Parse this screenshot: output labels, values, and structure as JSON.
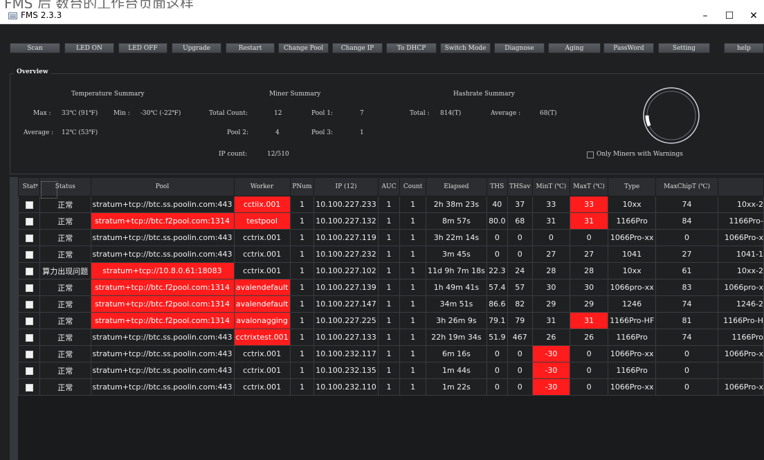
{
  "window": {
    "title": "FMS 2.3.3",
    "top_strip_text": "FMS 后 数台的工作台页面这样",
    "minimize": "–",
    "maximize": "☐",
    "close": "✕"
  },
  "toolbar": {
    "buttons": [
      "Scan",
      "LED ON",
      "LED OFF",
      "Upgrade",
      "Restart",
      "Change Pool",
      "Change IP",
      "To DHCP",
      "Switch Mode",
      "Diagnose",
      "Aging",
      "PassWord",
      "Setting",
      "help"
    ]
  },
  "overview": {
    "title": "Overview",
    "temperature": {
      "heading": "Temperature Summary",
      "max_label": "Max :",
      "max_value": "33℃ (91℉)",
      "min_label": "Min :",
      "min_value": "-30℃ (-22℉)",
      "avg_label": "Average :",
      "avg_value": "12℃ (53℉)"
    },
    "miner": {
      "heading": "Miner Summary",
      "total_label": "Total Count:",
      "total_value": "12",
      "pool1_label": "Pool 1:",
      "pool1_value": "7",
      "pool2_label": "Pool 2:",
      "pool2_value": "4",
      "pool3_label": "Pool 3:",
      "pool3_value": "1",
      "ip_label": "IP count:",
      "ip_value": "12/510"
    },
    "hashrate": {
      "heading": "Hashrate Summary",
      "total_label": "Total :",
      "total_value": "814(T)",
      "avg_label": "Average :",
      "avg_value": "68(T)"
    },
    "warnings_checkbox": "Only Miners with Warnings",
    "gauge_progress": 0.02
  },
  "table": {
    "columns": [
      "Stat",
      "Status",
      "Pool",
      "Worker",
      "PNum",
      "IP (12)",
      "AUC",
      "Count",
      "Elapsed",
      "THS",
      "THSav",
      "MinT (℃)",
      "MaxT (℃)",
      "Type",
      "MaxChipT (℃)",
      ""
    ],
    "rows": [
      {
        "status": "正常",
        "pool": "stratum+tcp://btc.ss.poolin.com:443",
        "worker": "cctiix.001",
        "pnum": "1",
        "ip": "10.100.227.233",
        "auc": "1",
        "count": "1",
        "elapsed": "2h 38m 23s",
        "ths": "40",
        "thsav": "37",
        "mint": "33",
        "maxt": "33",
        "type": "10xx",
        "maxchip": "74",
        "extra": "10xx-2",
        "red": [
          "worker",
          "maxt"
        ]
      },
      {
        "status": "正常",
        "pool": "stratum+tcp://btc.f2pool.com:1314",
        "worker": "testpool",
        "pnum": "1",
        "ip": "10.100.227.132",
        "auc": "1",
        "count": "1",
        "elapsed": "8m 57s",
        "ths": "80.0",
        "thsav": "68",
        "mint": "31",
        "maxt": "31",
        "type": "1166Pro",
        "maxchip": "84",
        "extra": "1166Pro-",
        "red": [
          "pool",
          "worker",
          "maxt"
        ]
      },
      {
        "status": "正常",
        "pool": "stratum+tcp://btc.ss.poolin.com:443",
        "worker": "cctrix.001",
        "pnum": "1",
        "ip": "10.100.227.119",
        "auc": "1",
        "count": "1",
        "elapsed": "3h 22m 14s",
        "ths": "0",
        "thsav": "0",
        "mint": "0",
        "maxt": "0",
        "type": "1066Pro-xx",
        "maxchip": "0",
        "extra": "1066Pro-x",
        "red": []
      },
      {
        "status": "正常",
        "pool": "stratum+tcp://btc.ss.poolin.com:443",
        "worker": "cctrix.001",
        "pnum": "1",
        "ip": "10.100.227.232",
        "auc": "1",
        "count": "1",
        "elapsed": "3m 45s",
        "ths": "0",
        "thsav": "0",
        "mint": "27",
        "maxt": "27",
        "type": "1041",
        "maxchip": "27",
        "extra": "1041-1",
        "red": []
      },
      {
        "status": "算力出现问题",
        "pool": "stratum+tcp://10.8.0.61:18083",
        "worker": "cctrix.001",
        "pnum": "1",
        "ip": "10.100.227.102",
        "auc": "1",
        "count": "1",
        "elapsed": "11d 9h 7m 18s",
        "ths": "22.3",
        "thsav": "24",
        "mint": "28",
        "maxt": "28",
        "type": "10xx",
        "maxchip": "61",
        "extra": "10xx-2",
        "red": [
          "pool"
        ]
      },
      {
        "status": "正常",
        "pool": "stratum+tcp://btc.f2pool.com:1314",
        "worker": "avalendefault",
        "pnum": "1",
        "ip": "10.100.227.139",
        "auc": "1",
        "count": "1",
        "elapsed": "1h 49m 41s",
        "ths": "57.4",
        "thsav": "57",
        "mint": "30",
        "maxt": "30",
        "type": "1066pro-xx",
        "maxchip": "83",
        "extra": "1066pro-x",
        "red": [
          "pool",
          "worker"
        ]
      },
      {
        "status": "正常",
        "pool": "stratum+tcp://btc.f2pool.com:1314",
        "worker": "avalendefault",
        "pnum": "1",
        "ip": "10.100.227.147",
        "auc": "1",
        "count": "1",
        "elapsed": "34m 51s",
        "ths": "86.6",
        "thsav": "82",
        "mint": "29",
        "maxt": "29",
        "type": "1246",
        "maxchip": "74",
        "extra": "1246-2",
        "red": [
          "pool",
          "worker"
        ]
      },
      {
        "status": "正常",
        "pool": "stratum+tcp://btc.f2pool.com:1314",
        "worker": "avalonagging",
        "pnum": "1",
        "ip": "10.100.227.225",
        "auc": "1",
        "count": "1",
        "elapsed": "3h 26m 9s",
        "ths": "79.1",
        "thsav": "79",
        "mint": "31",
        "maxt": "31",
        "type": "1166Pro-HF",
        "maxchip": "81",
        "extra": "1166Pro-H",
        "red": [
          "pool",
          "worker",
          "maxt"
        ]
      },
      {
        "status": "正常",
        "pool": "stratum+tcp://btc.ss.poolin.com:443",
        "worker": "cctrixtest.001",
        "pnum": "1",
        "ip": "10.100.227.133",
        "auc": "1",
        "count": "1",
        "elapsed": "22h 19m 34s",
        "ths": "51.9",
        "thsav": "467",
        "mint": "26",
        "maxt": "26",
        "type": "1166Pro",
        "maxchip": "74",
        "extra": "1166Pro",
        "red": [
          "worker"
        ]
      },
      {
        "status": "正常",
        "pool": "stratum+tcp://btc.ss.poolin.com:443",
        "worker": "cctrix.001",
        "pnum": "1",
        "ip": "10.100.232.117",
        "auc": "1",
        "count": "1",
        "elapsed": "6m 16s",
        "ths": "0",
        "thsav": "0",
        "mint": "-30",
        "maxt": "0",
        "type": "1066Pro-xx",
        "maxchip": "0",
        "extra": "1066Pro-x",
        "red": [
          "mint"
        ]
      },
      {
        "status": "正常",
        "pool": "stratum+tcp://btc.ss.poolin.com:443",
        "worker": "cctrix.001",
        "pnum": "1",
        "ip": "10.100.232.135",
        "auc": "1",
        "count": "1",
        "elapsed": "1m 44s",
        "ths": "0",
        "thsav": "0",
        "mint": "-30",
        "maxt": "0",
        "type": "1166Pro",
        "maxchip": "0",
        "extra": "",
        "red": [
          "mint"
        ]
      },
      {
        "status": "正常",
        "pool": "stratum+tcp://btc.ss.poolin.com:443",
        "worker": "cctrix.001",
        "pnum": "1",
        "ip": "10.100.232.110",
        "auc": "1",
        "count": "1",
        "elapsed": "1m 22s",
        "ths": "0",
        "thsav": "0",
        "mint": "-30",
        "maxt": "0",
        "type": "1066Pro-xx",
        "maxchip": "0",
        "extra": "1066Pro-x",
        "red": [
          "mint"
        ]
      }
    ]
  },
  "colors": {
    "background": "#1f2022",
    "alert_red": "#ff1c1c",
    "header": "#2b2d30"
  }
}
